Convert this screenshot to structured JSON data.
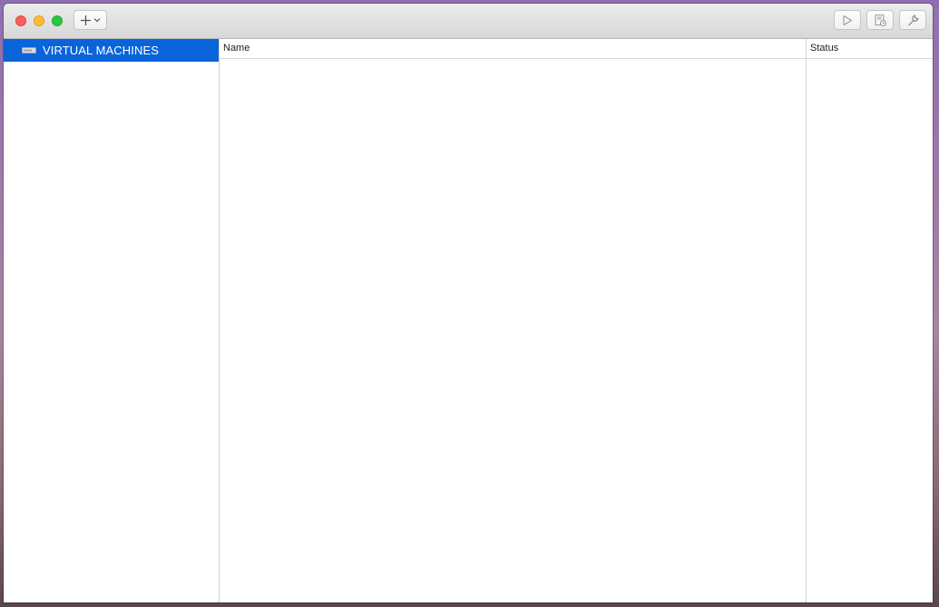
{
  "window": {
    "add_button_icon": "plus-icon",
    "add_menu_icon": "chevron-down-icon",
    "play_icon": "play-icon",
    "snapshot_icon": "snapshot-icon",
    "settings_icon": "wrench-icon"
  },
  "sidebar": {
    "items": [
      {
        "label": "VIRTUAL MACHINES",
        "icon": "drive-icon",
        "selected": true
      }
    ]
  },
  "table": {
    "columns": [
      "Name",
      "Status"
    ],
    "rows": []
  },
  "colors": {
    "selection": "#0a64d9",
    "close": "#fc5f57",
    "minimize": "#fdbc2e",
    "zoom": "#28c840"
  }
}
